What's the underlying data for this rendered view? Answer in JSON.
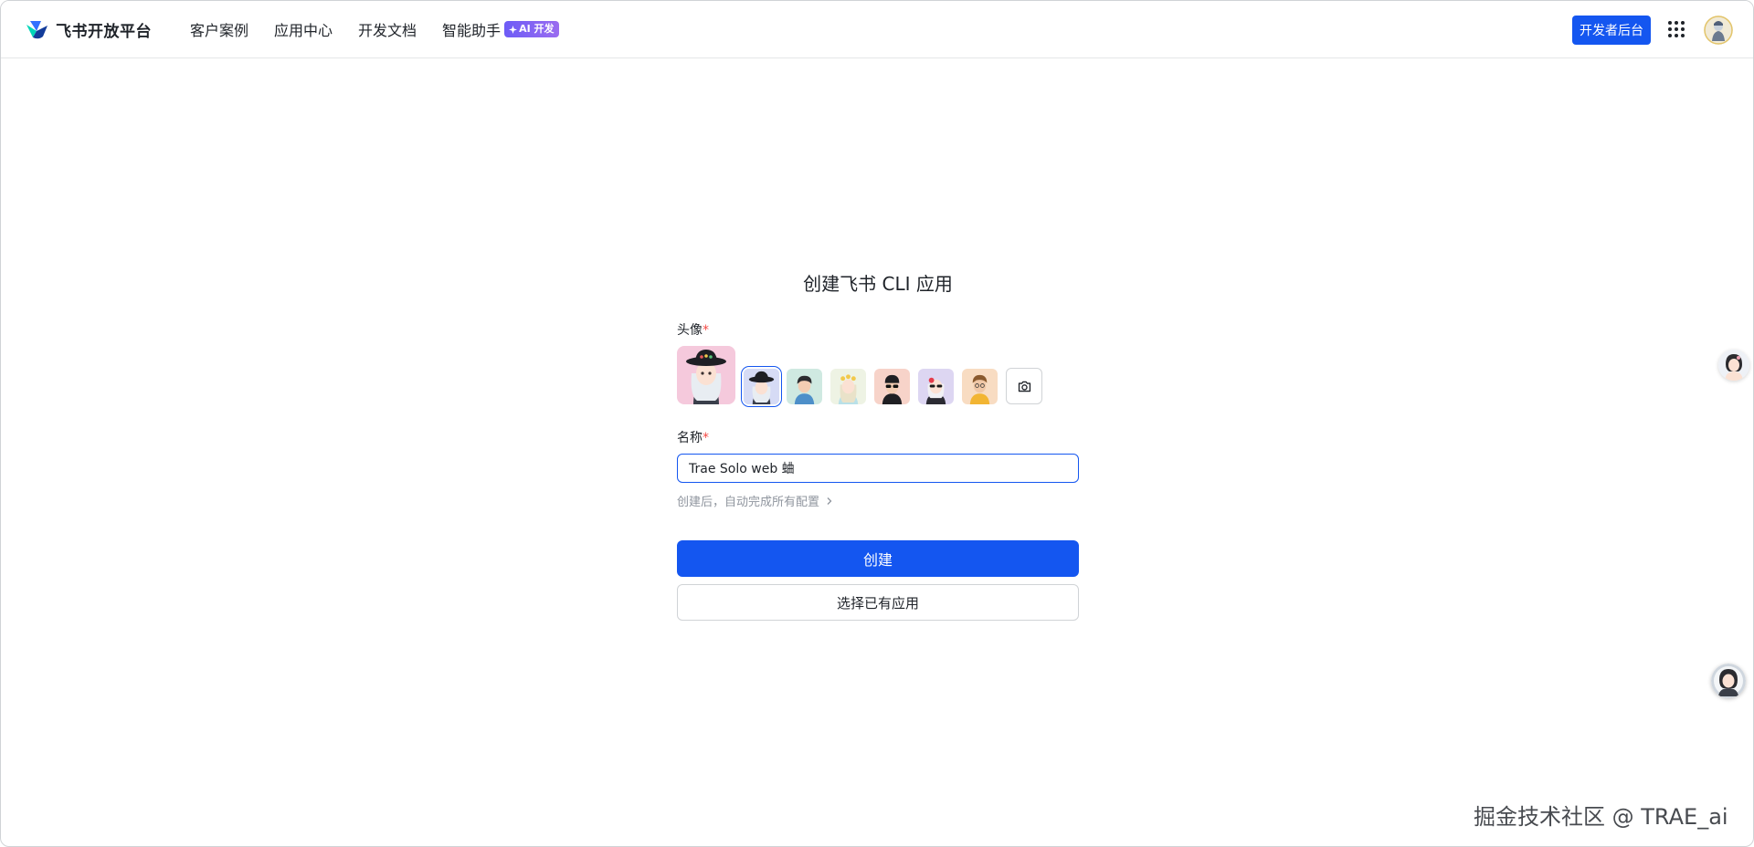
{
  "header": {
    "brand": "飞书开放平台",
    "nav": [
      "客户案例",
      "应用中心",
      "开发文档",
      "智能助手"
    ],
    "ai_badge": "AI 开发",
    "dev_console": "开发者后台",
    "icons": [
      "feishu-logo-icon",
      "sparkle-icon",
      "apps-grid-icon",
      "user-avatar"
    ]
  },
  "form": {
    "title": "创建飞书 CLI 应用",
    "avatar_label": "头像",
    "required_mark": "*",
    "name_label": "名称",
    "name_value": "Trae Solo web 蛐",
    "hint": "创建后，自动完成所有配置",
    "hint_icon": "chevron-right-icon",
    "upload_icon": "camera-icon",
    "avatar_options": [
      "avatar-hat-girl",
      "avatar-glasses-boy",
      "avatar-flower-girl",
      "avatar-sunglasses-boy",
      "avatar-rose-girl",
      "avatar-yellow-boy"
    ],
    "selected_avatar_index": 0,
    "create_button": "创建",
    "select_button": "选择已有应用"
  },
  "watermark": "掘金技术社区 @ TRAE_ai",
  "colors": {
    "primary": "#1456f0",
    "text": "#1f2329",
    "muted": "#8f959e",
    "required": "#f54a45",
    "ai_badge": "#7b63f5"
  }
}
